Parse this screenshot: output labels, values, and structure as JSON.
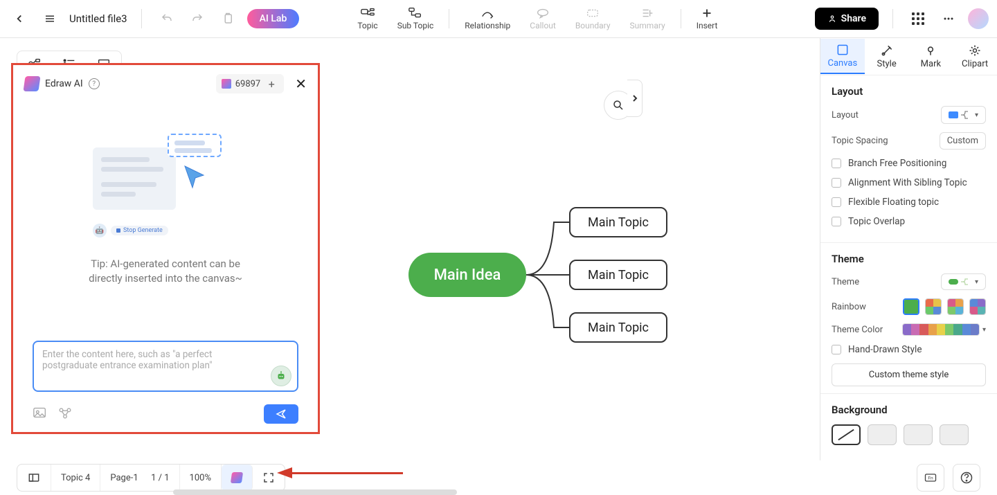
{
  "header": {
    "file_title": "Untitled file3",
    "ai_lab": "AI Lab",
    "share": "Share"
  },
  "toolbar": [
    {
      "id": "topic",
      "label": "Topic"
    },
    {
      "id": "subtopic",
      "label": "Sub Topic"
    },
    {
      "id": "relationship",
      "label": "Relationship"
    },
    {
      "id": "callout",
      "label": "Callout",
      "disabled": true
    },
    {
      "id": "boundary",
      "label": "Boundary",
      "disabled": true
    },
    {
      "id": "summary",
      "label": "Summary",
      "disabled": true
    },
    {
      "id": "insert",
      "label": "Insert"
    }
  ],
  "ai_panel": {
    "title": "Edraw AI",
    "credits": "69897",
    "stop_generate": "Stop Generate",
    "tip_line1": "Tip: AI-generated content can be",
    "tip_line2": "directly inserted into the canvas~",
    "input_placeholder": "Enter the content here, such as \"a perfect postgraduate entrance examination plan\""
  },
  "mindmap": {
    "root": "Main Idea",
    "topics": [
      "Main Topic",
      "Main Topic",
      "Main Topic"
    ]
  },
  "right_panel": {
    "tabs": [
      "Canvas",
      "Style",
      "Mark",
      "Clipart"
    ],
    "layout_section": "Layout",
    "layout_label": "Layout",
    "topic_spacing_label": "Topic Spacing",
    "topic_spacing_value": "Custom",
    "checkboxes": [
      "Branch Free Positioning",
      "Alignment With Sibling Topic",
      "Flexible Floating topic",
      "Topic Overlap"
    ],
    "theme_section": "Theme",
    "theme_label": "Theme",
    "rainbow_label": "Rainbow",
    "theme_color_label": "Theme Color",
    "hand_drawn": "Hand-Drawn Style",
    "custom_theme": "Custom theme style",
    "background_section": "Background"
  },
  "bottombar": {
    "topic_count": "Topic 4",
    "page_label": "Page-1",
    "page_num": "1 / 1",
    "zoom": "100%"
  },
  "theme_colors": [
    "#8a6bc9",
    "#c96bb3",
    "#d85a5a",
    "#e8a14a",
    "#e8d14a",
    "#7cc96b",
    "#4aa88a",
    "#5a8ad8",
    "#6b7cc9"
  ],
  "rainbow_palettes": [
    [
      "#4cae4c",
      "#4cae4c",
      "#4cae4c",
      "#4cae4c"
    ],
    [
      "#e86b4a",
      "#e8c24a",
      "#6bc96b",
      "#5a8ad8"
    ],
    [
      "#d85a8a",
      "#e8a14a",
      "#7cc96b",
      "#5ab3d8"
    ],
    [
      "#5a8ad8",
      "#8a6bc9",
      "#d85a8a",
      "#5ab3b3"
    ]
  ]
}
